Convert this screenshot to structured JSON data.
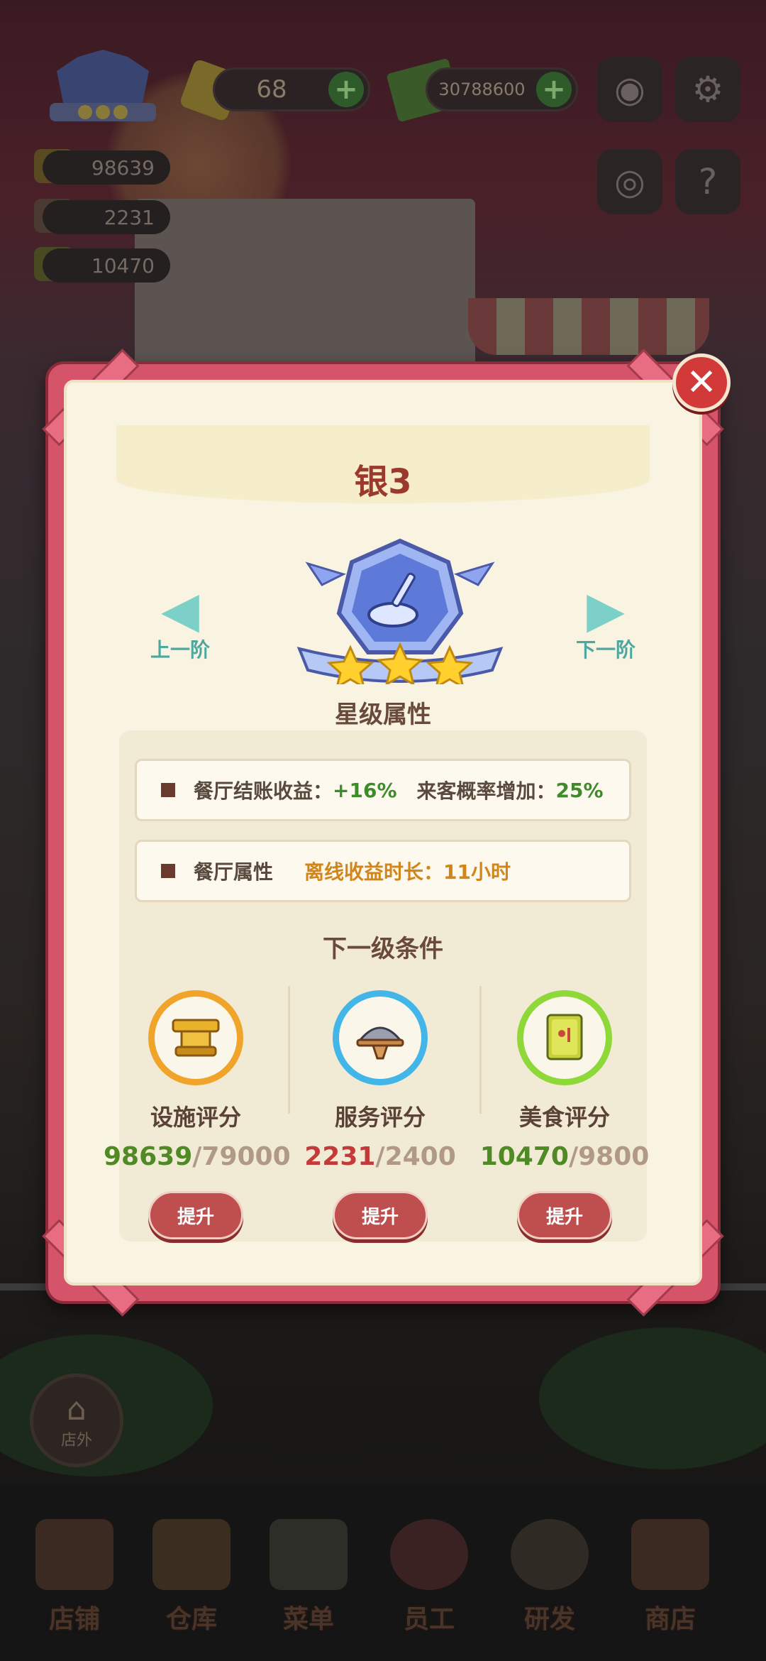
{
  "hud": {
    "gems": "68",
    "cash": "30788600",
    "stats": [
      "98639",
      "2231",
      "10470"
    ]
  },
  "modal": {
    "title": "银3",
    "prev_label": "上一阶",
    "next_label": "下一阶",
    "star_count": 3,
    "star_section_title": "星级属性",
    "attributes": [
      {
        "label": "餐厅结账收益：",
        "value": "+16%",
        "label2": "来客概率增加：",
        "value2": "25%"
      },
      {
        "label": "餐厅属性",
        "value": "离线收益时长：11小时"
      }
    ],
    "next_level_title": "下一级条件",
    "requirements": [
      {
        "name": "设施评分",
        "current": "98639",
        "target": "/79000",
        "ring_color": "#f0a42a",
        "icon": "facility-icon",
        "button": "提升"
      },
      {
        "name": "服务评分",
        "current": "2231",
        "target": "/2400",
        "ring_color": "#42b6e8",
        "icon": "service-icon",
        "button": "提升"
      },
      {
        "name": "美食评分",
        "current": "10470",
        "target": "/9800",
        "ring_color": "#8ed83a",
        "icon": "recipe-book-icon",
        "button": "提升"
      }
    ]
  },
  "bottom": {
    "outside_label": "店外",
    "tabs": [
      "店铺",
      "仓库",
      "菜单",
      "员工",
      "研发",
      "商店"
    ]
  }
}
